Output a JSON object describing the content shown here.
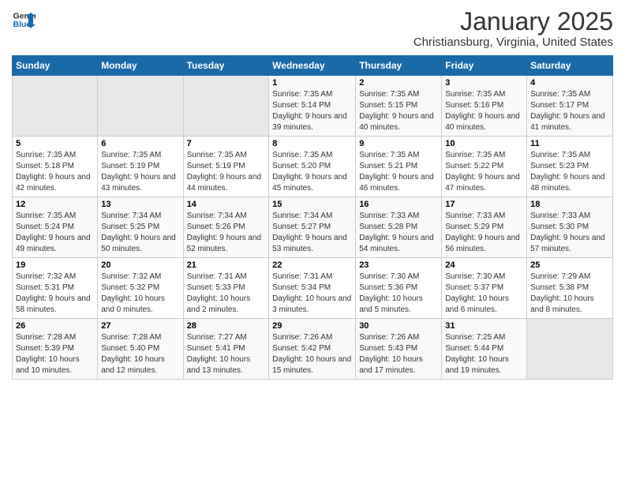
{
  "header": {
    "logo_line1": "General",
    "logo_line2": "Blue",
    "month_title": "January 2025",
    "location": "Christiansburg, Virginia, United States"
  },
  "days_of_week": [
    "Sunday",
    "Monday",
    "Tuesday",
    "Wednesday",
    "Thursday",
    "Friday",
    "Saturday"
  ],
  "weeks": [
    [
      {
        "day": "",
        "empty": true
      },
      {
        "day": "",
        "empty": true
      },
      {
        "day": "",
        "empty": true
      },
      {
        "day": "1",
        "sunrise": "7:35 AM",
        "sunset": "5:14 PM",
        "daylight": "9 hours and 39 minutes."
      },
      {
        "day": "2",
        "sunrise": "7:35 AM",
        "sunset": "5:15 PM",
        "daylight": "9 hours and 40 minutes."
      },
      {
        "day": "3",
        "sunrise": "7:35 AM",
        "sunset": "5:16 PM",
        "daylight": "9 hours and 40 minutes."
      },
      {
        "day": "4",
        "sunrise": "7:35 AM",
        "sunset": "5:17 PM",
        "daylight": "9 hours and 41 minutes."
      }
    ],
    [
      {
        "day": "5",
        "sunrise": "7:35 AM",
        "sunset": "5:18 PM",
        "daylight": "9 hours and 42 minutes."
      },
      {
        "day": "6",
        "sunrise": "7:35 AM",
        "sunset": "5:19 PM",
        "daylight": "9 hours and 43 minutes."
      },
      {
        "day": "7",
        "sunrise": "7:35 AM",
        "sunset": "5:19 PM",
        "daylight": "9 hours and 44 minutes."
      },
      {
        "day": "8",
        "sunrise": "7:35 AM",
        "sunset": "5:20 PM",
        "daylight": "9 hours and 45 minutes."
      },
      {
        "day": "9",
        "sunrise": "7:35 AM",
        "sunset": "5:21 PM",
        "daylight": "9 hours and 46 minutes."
      },
      {
        "day": "10",
        "sunrise": "7:35 AM",
        "sunset": "5:22 PM",
        "daylight": "9 hours and 47 minutes."
      },
      {
        "day": "11",
        "sunrise": "7:35 AM",
        "sunset": "5:23 PM",
        "daylight": "9 hours and 48 minutes."
      }
    ],
    [
      {
        "day": "12",
        "sunrise": "7:35 AM",
        "sunset": "5:24 PM",
        "daylight": "9 hours and 49 minutes."
      },
      {
        "day": "13",
        "sunrise": "7:34 AM",
        "sunset": "5:25 PM",
        "daylight": "9 hours and 50 minutes."
      },
      {
        "day": "14",
        "sunrise": "7:34 AM",
        "sunset": "5:26 PM",
        "daylight": "9 hours and 52 minutes."
      },
      {
        "day": "15",
        "sunrise": "7:34 AM",
        "sunset": "5:27 PM",
        "daylight": "9 hours and 53 minutes."
      },
      {
        "day": "16",
        "sunrise": "7:33 AM",
        "sunset": "5:28 PM",
        "daylight": "9 hours and 54 minutes."
      },
      {
        "day": "17",
        "sunrise": "7:33 AM",
        "sunset": "5:29 PM",
        "daylight": "9 hours and 56 minutes."
      },
      {
        "day": "18",
        "sunrise": "7:33 AM",
        "sunset": "5:30 PM",
        "daylight": "9 hours and 57 minutes."
      }
    ],
    [
      {
        "day": "19",
        "sunrise": "7:32 AM",
        "sunset": "5:31 PM",
        "daylight": "9 hours and 58 minutes."
      },
      {
        "day": "20",
        "sunrise": "7:32 AM",
        "sunset": "5:32 PM",
        "daylight": "10 hours and 0 minutes."
      },
      {
        "day": "21",
        "sunrise": "7:31 AM",
        "sunset": "5:33 PM",
        "daylight": "10 hours and 2 minutes."
      },
      {
        "day": "22",
        "sunrise": "7:31 AM",
        "sunset": "5:34 PM",
        "daylight": "10 hours and 3 minutes."
      },
      {
        "day": "23",
        "sunrise": "7:30 AM",
        "sunset": "5:36 PM",
        "daylight": "10 hours and 5 minutes."
      },
      {
        "day": "24",
        "sunrise": "7:30 AM",
        "sunset": "5:37 PM",
        "daylight": "10 hours and 6 minutes."
      },
      {
        "day": "25",
        "sunrise": "7:29 AM",
        "sunset": "5:38 PM",
        "daylight": "10 hours and 8 minutes."
      }
    ],
    [
      {
        "day": "26",
        "sunrise": "7:28 AM",
        "sunset": "5:39 PM",
        "daylight": "10 hours and 10 minutes."
      },
      {
        "day": "27",
        "sunrise": "7:28 AM",
        "sunset": "5:40 PM",
        "daylight": "10 hours and 12 minutes."
      },
      {
        "day": "28",
        "sunrise": "7:27 AM",
        "sunset": "5:41 PM",
        "daylight": "10 hours and 13 minutes."
      },
      {
        "day": "29",
        "sunrise": "7:26 AM",
        "sunset": "5:42 PM",
        "daylight": "10 hours and 15 minutes."
      },
      {
        "day": "30",
        "sunrise": "7:26 AM",
        "sunset": "5:43 PM",
        "daylight": "10 hours and 17 minutes."
      },
      {
        "day": "31",
        "sunrise": "7:25 AM",
        "sunset": "5:44 PM",
        "daylight": "10 hours and 19 minutes."
      },
      {
        "day": "",
        "empty": true
      }
    ]
  ]
}
